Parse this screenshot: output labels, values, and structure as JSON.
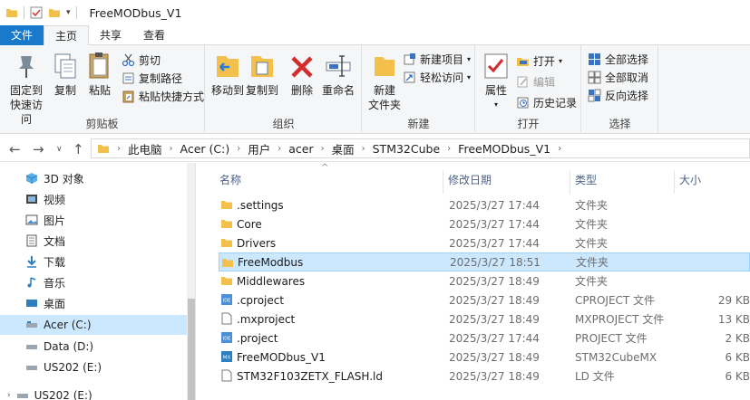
{
  "window": {
    "title": "FreeMODbus_V1"
  },
  "tabs": [
    {
      "label": "文件"
    },
    {
      "label": "主页"
    },
    {
      "label": "共享"
    },
    {
      "label": "查看"
    }
  ],
  "ribbon": {
    "clipboard": {
      "pin_label": "固定到\n快速访问",
      "copy_label": "复制",
      "paste_label": "粘贴",
      "cut_label": "剪切",
      "copy_path_label": "复制路径",
      "paste_shortcut_label": "粘贴快捷方式",
      "group_label": "剪贴板"
    },
    "organize": {
      "move_to_label": "移动到",
      "copy_to_label": "复制到",
      "delete_label": "删除",
      "rename_label": "重命名",
      "group_label": "组织"
    },
    "new": {
      "new_folder_label": "新建\n文件夹",
      "new_item_label": "新建项目",
      "easy_access_label": "轻松访问",
      "group_label": "新建"
    },
    "open": {
      "properties_label": "属性",
      "open_label": "打开",
      "edit_label": "编辑",
      "history_label": "历史记录",
      "group_label": "打开"
    },
    "select": {
      "select_all_label": "全部选择",
      "select_none_label": "全部取消",
      "invert_label": "反向选择",
      "group_label": "选择"
    }
  },
  "address": {
    "crumbs": [
      "此电脑",
      "Acer (C:)",
      "用户",
      "acer",
      "桌面",
      "STM32Cube",
      "FreeMODbus_V1"
    ]
  },
  "navpane": {
    "items": [
      {
        "label": "3D 对象",
        "icon": "3d-objects-icon"
      },
      {
        "label": "视频",
        "icon": "video-icon"
      },
      {
        "label": "图片",
        "icon": "pictures-icon"
      },
      {
        "label": "文档",
        "icon": "documents-icon"
      },
      {
        "label": "下载",
        "icon": "download-icon"
      },
      {
        "label": "音乐",
        "icon": "music-icon"
      },
      {
        "label": "桌面",
        "icon": "desktop-icon"
      },
      {
        "label": "Acer (C:)",
        "icon": "drive-icon"
      },
      {
        "label": "Data (D:)",
        "icon": "drive-icon"
      },
      {
        "label": "US202 (E:)",
        "icon": "usb-drive-icon"
      },
      {
        "label": "US202 (E:)",
        "icon": "usb-drive-icon"
      }
    ]
  },
  "columns": {
    "name": "名称",
    "date": "修改日期",
    "type": "类型",
    "size": "大小"
  },
  "files": [
    {
      "name": ".settings",
      "date": "2025/3/27 17:44",
      "type": "文件夹",
      "size": "",
      "icon": "folder-icon"
    },
    {
      "name": "Core",
      "date": "2025/3/27 17:44",
      "type": "文件夹",
      "size": "",
      "icon": "folder-icon"
    },
    {
      "name": "Drivers",
      "date": "2025/3/27 17:44",
      "type": "文件夹",
      "size": "",
      "icon": "folder-icon"
    },
    {
      "name": "FreeModbus",
      "date": "2025/3/27 18:51",
      "type": "文件夹",
      "size": "",
      "icon": "folder-icon"
    },
    {
      "name": "Middlewares",
      "date": "2025/3/27 18:49",
      "type": "文件夹",
      "size": "",
      "icon": "folder-icon"
    },
    {
      "name": ".cproject",
      "date": "2025/3/27 18:49",
      "type": "CPROJECT 文件",
      "size": "29 KB",
      "icon": "ide-file-icon"
    },
    {
      "name": ".mxproject",
      "date": "2025/3/27 18:49",
      "type": "MXPROJECT 文件",
      "size": "13 KB",
      "icon": "file-icon"
    },
    {
      "name": ".project",
      "date": "2025/3/27 17:44",
      "type": "PROJECT 文件",
      "size": "2 KB",
      "icon": "ide-file-icon"
    },
    {
      "name": "FreeMODbus_V1",
      "date": "2025/3/27 18:49",
      "type": "STM32CubeMX",
      "size": "6 KB",
      "icon": "mx-file-icon"
    },
    {
      "name": "STM32F103ZETX_FLASH.ld",
      "date": "2025/3/27 18:49",
      "type": "LD 文件",
      "size": "6 KB",
      "icon": "file-icon"
    }
  ],
  "colors": {
    "accent": "#1979ca",
    "selection": "#cce8ff",
    "folder": "#f3c14b"
  }
}
